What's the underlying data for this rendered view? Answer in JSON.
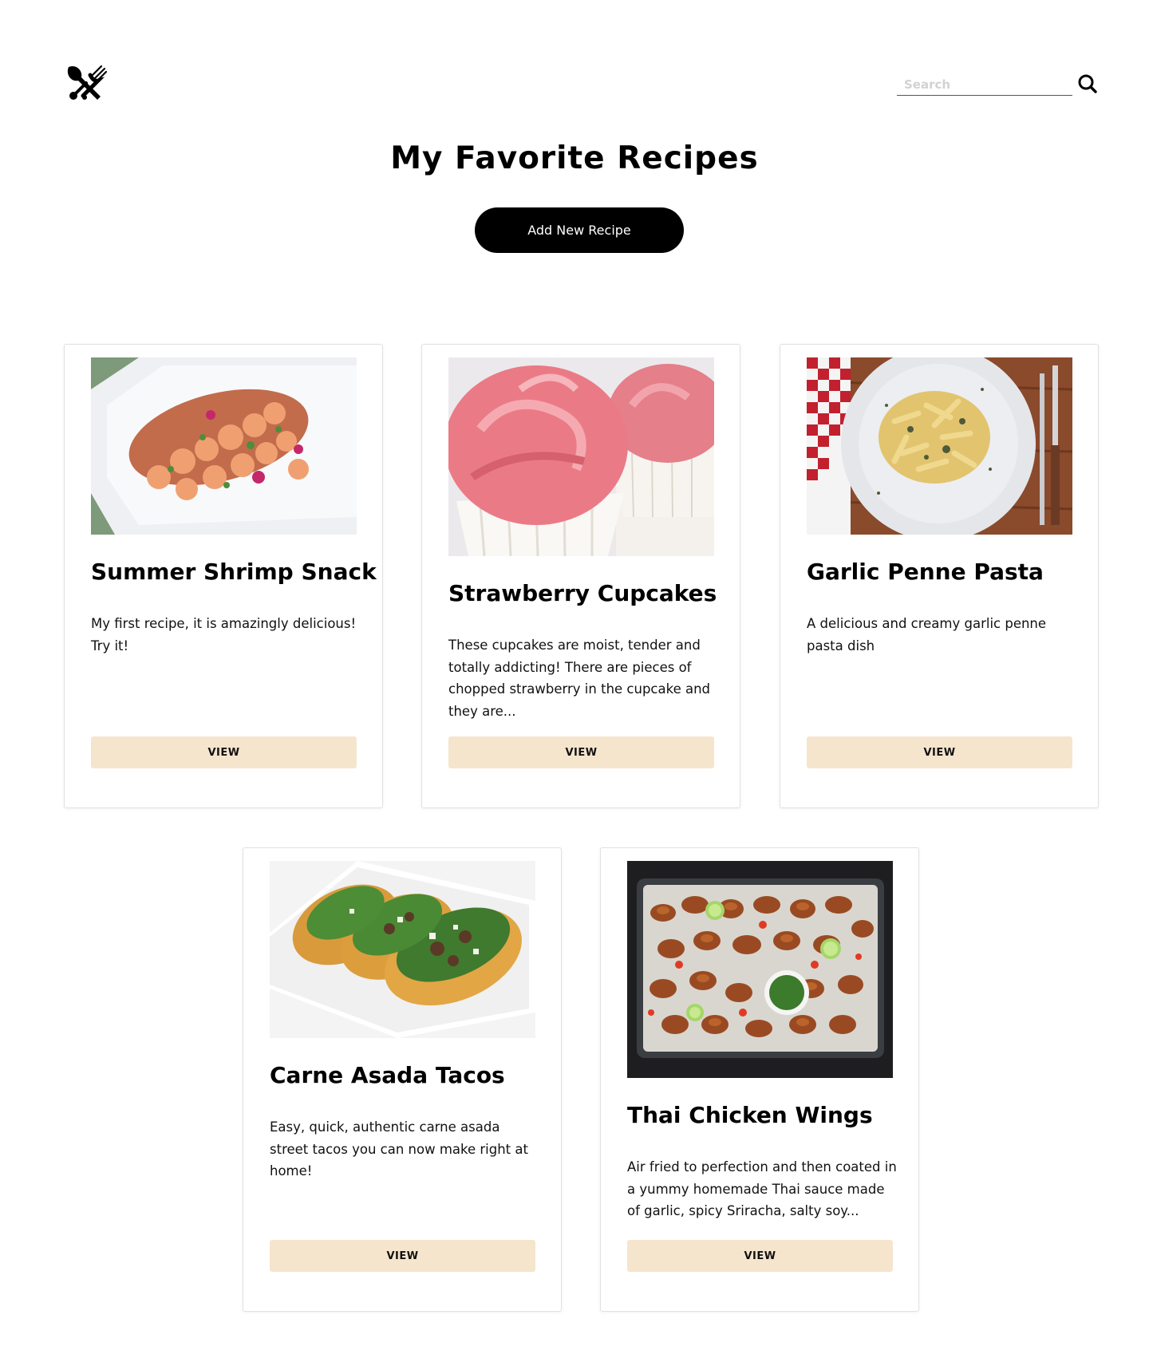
{
  "header": {
    "logo_icon": "utensils-crossed-icon",
    "search": {
      "placeholder": "Search",
      "value": "",
      "icon": "search-icon"
    }
  },
  "page": {
    "title": "My Favorite Recipes",
    "add_button_label": "Add New Recipe"
  },
  "colors": {
    "primary": "#000000",
    "view_button_bg": "#f6e5cd",
    "card_border": "#e1e1e1"
  },
  "recipes": [
    {
      "title": "Summer Shrimp Snack",
      "description": "My first recipe, it is amazingly delicious! Try it!",
      "button_label": "VIEW",
      "image": "shrimp-platter-photo"
    },
    {
      "title": "Strawberry Cupcakes",
      "description": "These cupcakes are moist, tender and totally addicting! There are pieces of chopped strawberry in the cupcake and they are...",
      "button_label": "VIEW",
      "image": "pink-frosted-cupcakes-photo"
    },
    {
      "title": "Garlic Penne Pasta",
      "description": "A delicious and creamy garlic penne pasta dish",
      "button_label": "VIEW",
      "image": "penne-pasta-plate-photo"
    },
    {
      "title": "Carne Asada Tacos",
      "description": "Easy, quick, authentic carne asada street tacos you can now make right at home!",
      "button_label": "VIEW",
      "image": "street-tacos-photo"
    },
    {
      "title": "Thai Chicken Wings",
      "description": "Air fried to perfection and then coated in a yummy homemade Thai sauce made of garlic, spicy Sriracha, salty soy...",
      "button_label": "VIEW",
      "image": "chicken-wings-tray-photo"
    }
  ]
}
